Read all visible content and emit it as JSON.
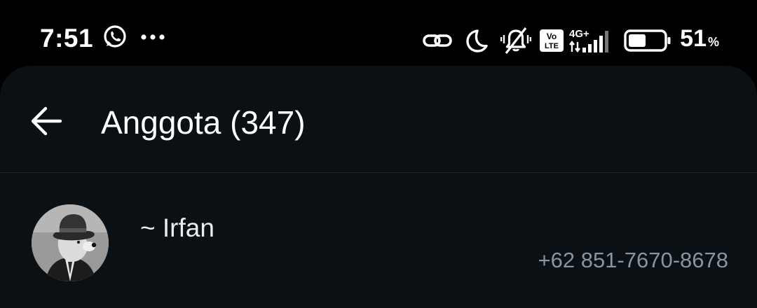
{
  "status_bar": {
    "time": "7:51",
    "left_icons": [
      "whatsapp-icon",
      "more-dots-icon"
    ],
    "right_icons": [
      "link-icon",
      "moon-icon",
      "vibrate-off-icon",
      "volte-icon",
      "signal-4g-icon",
      "battery-icon"
    ],
    "volte_text_top": "Vo",
    "volte_text_bottom": "LTE",
    "network_type": "4G+",
    "battery_level": 0.51,
    "battery_value": "51",
    "battery_unit": "%"
  },
  "header": {
    "back_icon": "arrow-left-icon",
    "title": "Anggota (347)"
  },
  "members": [
    {
      "name": "~ Irfan",
      "phone": "+62 851-7670-8678",
      "avatar": "avatar-dog-in-fedora"
    }
  ],
  "colors": {
    "status_bar_bg": "#000000",
    "panel_bg": "#0b1014",
    "primary_text": "#ffffff",
    "secondary_text": "#8696a0",
    "divider": "#22292e"
  }
}
